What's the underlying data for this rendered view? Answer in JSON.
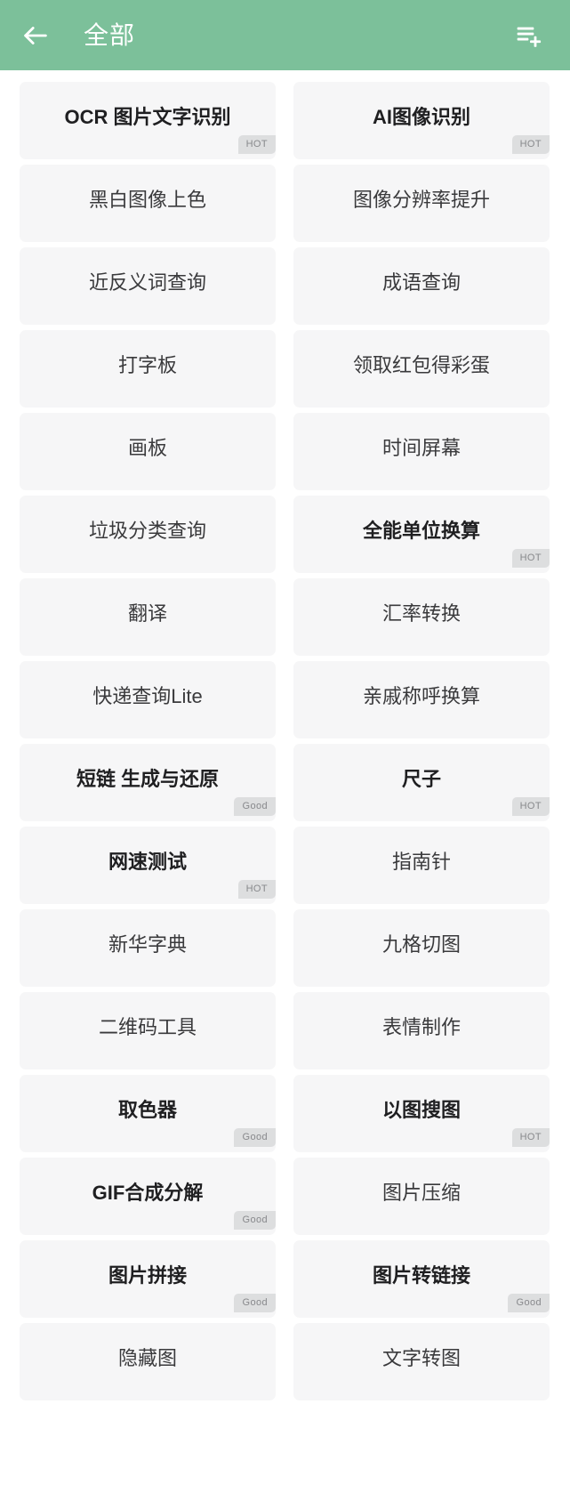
{
  "header": {
    "title": "全部",
    "back_icon": "arrow-left-icon",
    "action_icon": "playlist-add-icon",
    "background_color": "#7cc09a",
    "text_color": "#ffffff"
  },
  "badges": {
    "hot": "HOT",
    "good": "Good",
    "background_color": "#dddedf",
    "text_color": "#88898c"
  },
  "grid": {
    "card_background": "#f6f6f7",
    "card_text_color": "#3a3a3c",
    "columns": 2,
    "items": [
      {
        "label": "OCR 图片文字识别",
        "badge": "HOT",
        "featured": true
      },
      {
        "label": "AI图像识别",
        "badge": "HOT",
        "featured": true
      },
      {
        "label": "黑白图像上色",
        "badge": null,
        "featured": false
      },
      {
        "label": "图像分辨率提升",
        "badge": null,
        "featured": false
      },
      {
        "label": "近反义词查询",
        "badge": null,
        "featured": false
      },
      {
        "label": "成语查询",
        "badge": null,
        "featured": false
      },
      {
        "label": "打字板",
        "badge": null,
        "featured": false
      },
      {
        "label": "领取红包得彩蛋",
        "badge": null,
        "featured": false
      },
      {
        "label": "画板",
        "badge": null,
        "featured": false
      },
      {
        "label": "时间屏幕",
        "badge": null,
        "featured": false
      },
      {
        "label": "垃圾分类查询",
        "badge": null,
        "featured": false
      },
      {
        "label": "全能单位换算",
        "badge": "HOT",
        "featured": true
      },
      {
        "label": "翻译",
        "badge": null,
        "featured": false
      },
      {
        "label": "汇率转换",
        "badge": null,
        "featured": false
      },
      {
        "label": "快递查询Lite",
        "badge": null,
        "featured": false
      },
      {
        "label": "亲戚称呼换算",
        "badge": null,
        "featured": false
      },
      {
        "label": "短链 生成与还原",
        "badge": "Good",
        "featured": true
      },
      {
        "label": "尺子",
        "badge": "HOT",
        "featured": true
      },
      {
        "label": "网速测试",
        "badge": "HOT",
        "featured": true
      },
      {
        "label": "指南针",
        "badge": null,
        "featured": false
      },
      {
        "label": "新华字典",
        "badge": null,
        "featured": false
      },
      {
        "label": "九格切图",
        "badge": null,
        "featured": false
      },
      {
        "label": "二维码工具",
        "badge": null,
        "featured": false
      },
      {
        "label": "表情制作",
        "badge": null,
        "featured": false
      },
      {
        "label": "取色器",
        "badge": "Good",
        "featured": true
      },
      {
        "label": "以图搜图",
        "badge": "HOT",
        "featured": true
      },
      {
        "label": "GIF合成分解",
        "badge": "Good",
        "featured": true
      },
      {
        "label": "图片压缩",
        "badge": null,
        "featured": false
      },
      {
        "label": "图片拼接",
        "badge": "Good",
        "featured": true
      },
      {
        "label": "图片转链接",
        "badge": "Good",
        "featured": true
      },
      {
        "label": "隐藏图",
        "badge": null,
        "featured": false
      },
      {
        "label": "文字转图",
        "badge": null,
        "featured": false
      }
    ]
  }
}
